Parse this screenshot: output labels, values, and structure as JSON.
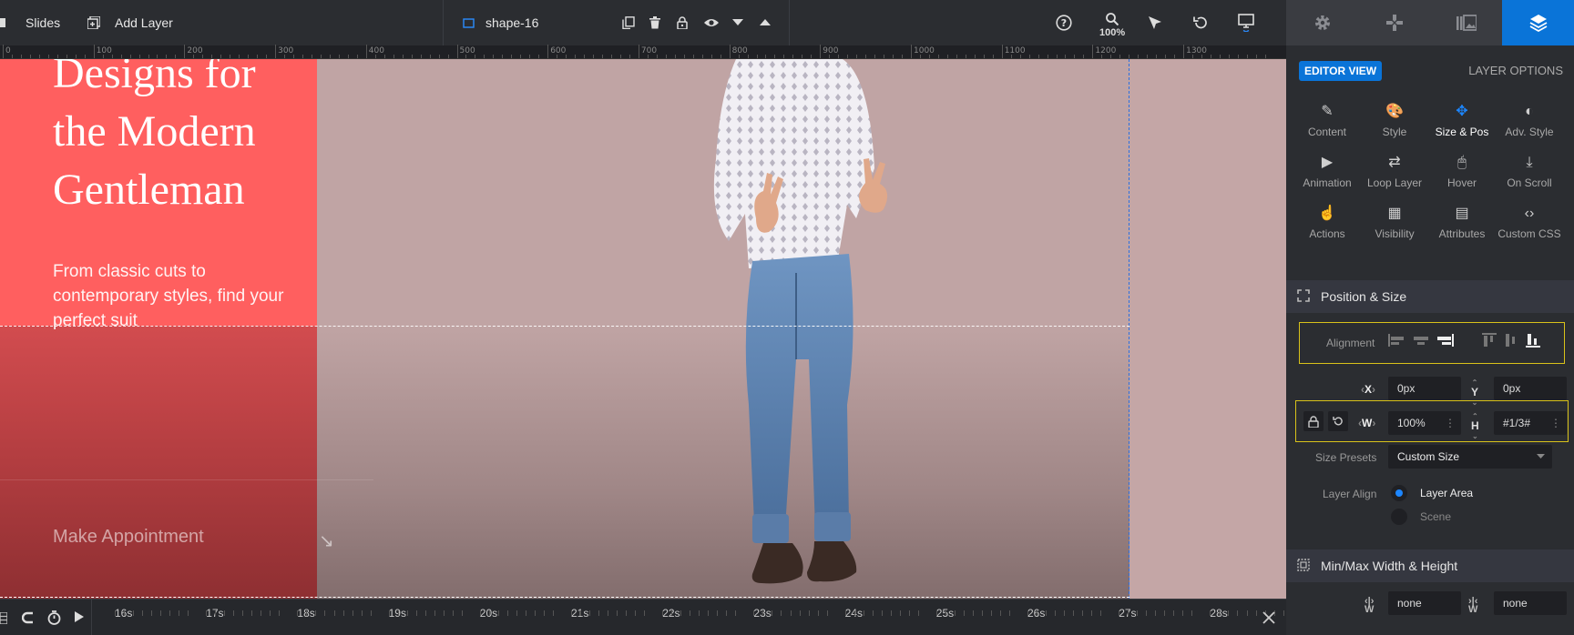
{
  "toolbar": {
    "slides_label": "Slides",
    "add_layer_label": "Add Layer",
    "layer_name": "shape-16",
    "zoom_level": "100%"
  },
  "right_tabs": [
    "gear-icon",
    "gamepad-icon",
    "media-library-icon",
    "layers-icon"
  ],
  "ruler": {
    "labels": [
      "0",
      "100",
      "200",
      "300",
      "400",
      "500",
      "600",
      "700",
      "800",
      "900",
      "1000",
      "1100",
      "1200",
      "1300"
    ]
  },
  "canvas": {
    "headline_lines": [
      "Designs for",
      "the Modern",
      "Gentleman"
    ],
    "subtext_lines": [
      "From classic cuts to",
      "contemporary styles, find your",
      "perfect suit"
    ],
    "cta_label": "Make Appointment",
    "cta_arrow": "↘"
  },
  "timeline": {
    "labels": [
      "16s",
      "17s",
      "18s",
      "19s",
      "20s",
      "21s",
      "22s",
      "23s",
      "24s",
      "25s",
      "26s",
      "27s",
      "28s"
    ]
  },
  "panel": {
    "editor_view": "EDITOR VIEW",
    "layer_options": "LAYER OPTIONS",
    "options": [
      {
        "label": "Content",
        "icon": "pencil-icon",
        "glyph": "✎"
      },
      {
        "label": "Style",
        "icon": "palette-icon",
        "glyph": "🎨"
      },
      {
        "label": "Size & Pos",
        "icon": "move-icon",
        "glyph": "✥"
      },
      {
        "label": "Adv. Style",
        "icon": "contrast-icon",
        "glyph": "◐"
      },
      {
        "label": "Animation",
        "icon": "play-icon",
        "glyph": "▶"
      },
      {
        "label": "Loop Layer",
        "icon": "loop-icon",
        "glyph": "⇄"
      },
      {
        "label": "Hover",
        "icon": "mouse-icon",
        "glyph": "🖱"
      },
      {
        "label": "On Scroll",
        "icon": "scroll-icon",
        "glyph": "⤓"
      },
      {
        "label": "Actions",
        "icon": "hand-pointer-icon",
        "glyph": "☝"
      },
      {
        "label": "Visibility",
        "icon": "visibility-icon",
        "glyph": "▦"
      },
      {
        "label": "Attributes",
        "icon": "document-icon",
        "glyph": "▤"
      },
      {
        "label": "Custom CSS",
        "icon": "code-icon",
        "glyph": "‹›"
      }
    ],
    "active_option": 2,
    "position_size_title": "Position & Size",
    "alignment_label": "Alignment",
    "x_value": "0px",
    "y_value": "0px",
    "w_value": "100%",
    "h_value": "#1/3#",
    "size_presets_label": "Size Presets",
    "size_presets_value": "Custom Size",
    "layer_align_label": "Layer Align",
    "layer_align_options": [
      "Layer Area",
      "Scene"
    ],
    "minmax_title": "Min/Max Width & Height",
    "min_w_value": "none",
    "max_w_value": "none"
  },
  "colors": {
    "accent": "#0a74d8",
    "canvas_bg": "#c0a4a4",
    "red_block": "#ff5f5f",
    "highlight": "#d9c21a"
  }
}
